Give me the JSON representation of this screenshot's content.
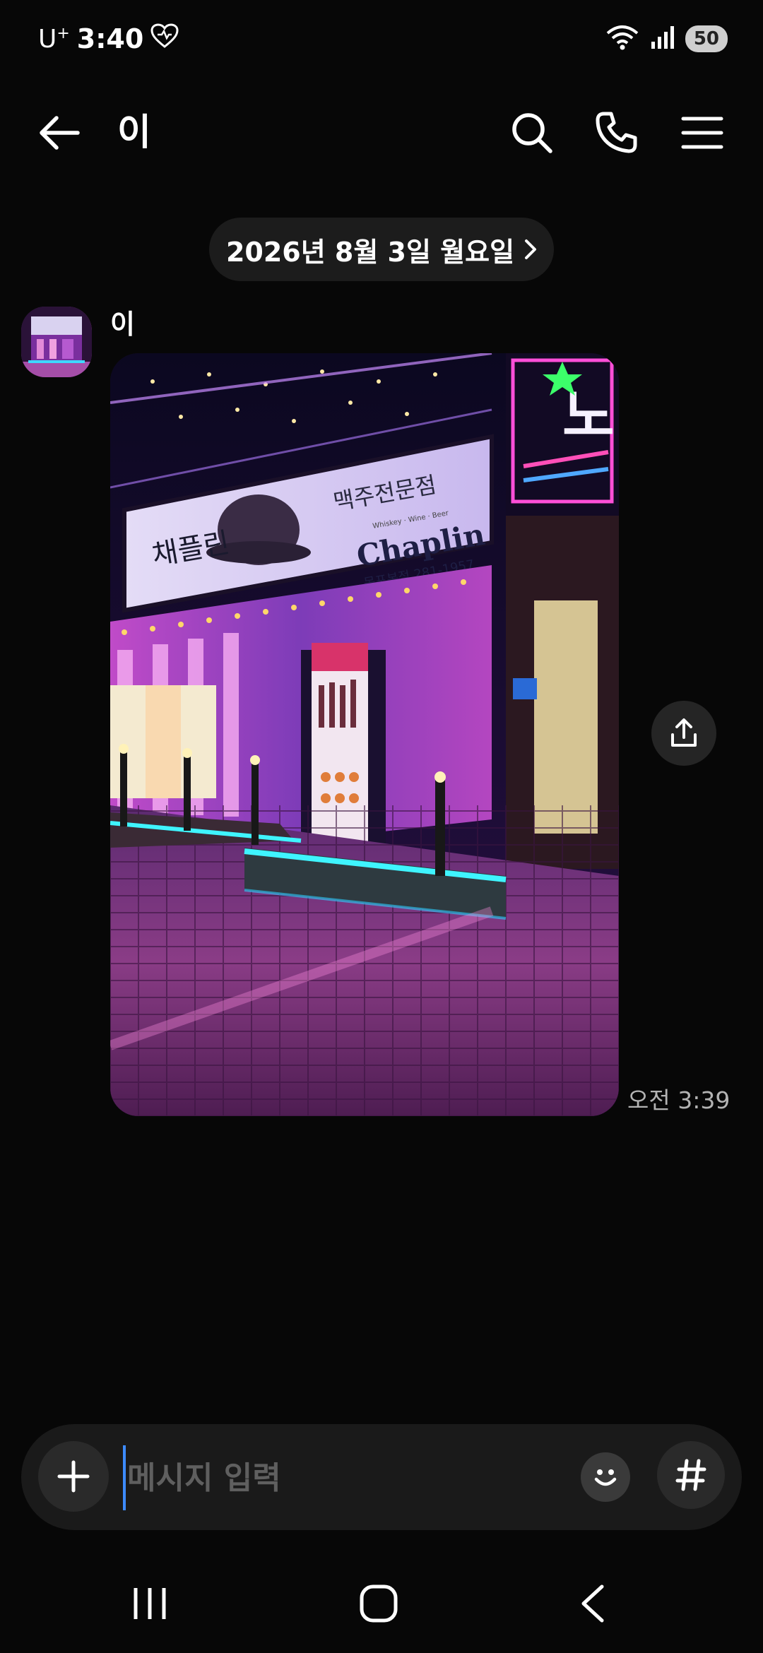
{
  "status_bar": {
    "carrier": "U",
    "carrier_sup": "+",
    "time": "3:40",
    "battery": "50"
  },
  "header": {
    "title": "이"
  },
  "date_pill": {
    "label": "2026년 8월 3일 월요일"
  },
  "message": {
    "sender": "이",
    "time": "오전 3:39",
    "photo": {
      "sign_main": "채플린",
      "sign_sub": "맥주전문점",
      "sign_brand": "Chaplin",
      "sign_tag": "Whiskey · Wine · Beer",
      "sign_phone": "목포본점 281-1957",
      "neon_char": "노"
    }
  },
  "composer": {
    "placeholder": "메시지 입력"
  },
  "colors": {
    "background": "#070707",
    "pill": "#1c1c1c",
    "composer": "#1a1a1a",
    "caret": "#3d8bff"
  }
}
